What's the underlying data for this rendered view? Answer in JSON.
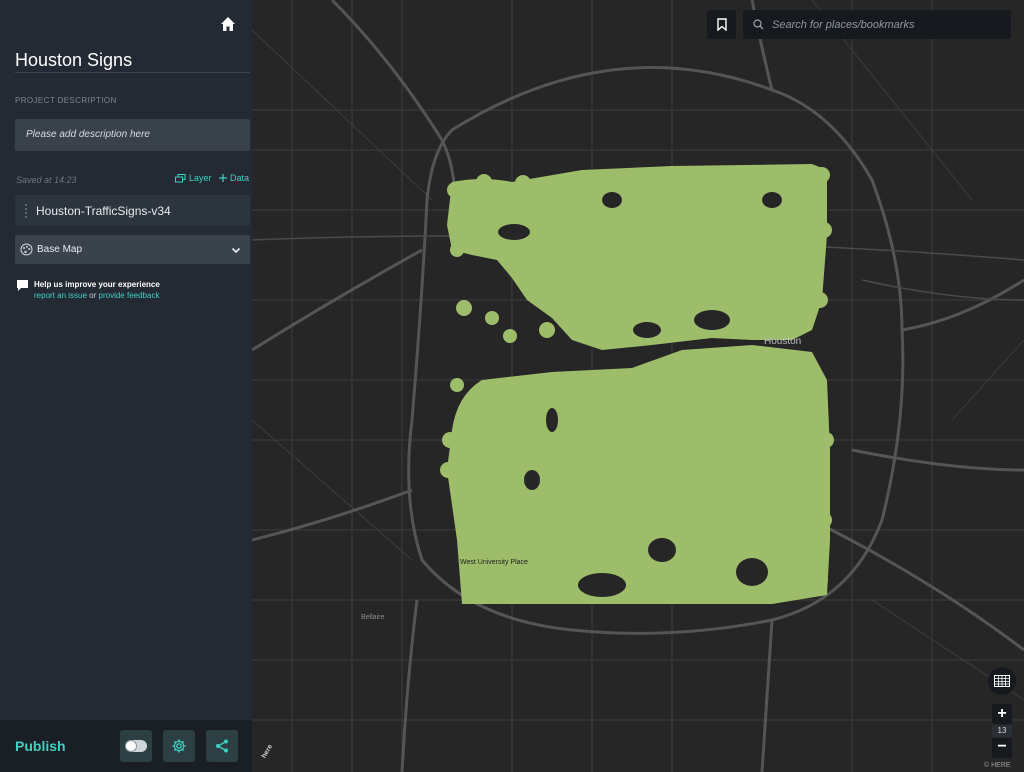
{
  "app": {
    "project_title": "Houston Signs",
    "project_description_label": "PROJECT DESCRIPTION",
    "description_placeholder": "Please add description here",
    "saved_at": "Saved at 14:23",
    "add_layer_label": "Layer",
    "add_data_label": "Data",
    "dataset_name": "Houston-TrafficSigns-v34",
    "basemap_label": "Base Map",
    "help_title": "Help us improve your experience",
    "help_report": "report an issue",
    "help_or": "or",
    "help_feedback": "provide feedback",
    "publish_label": "Publish"
  },
  "map": {
    "search_placeholder": "Search for places/bookmarks",
    "zoom_level": "13",
    "labels": {
      "houston": "Houston",
      "west_university_place": "West University Place",
      "bellaire": "Bellaire",
      "here_logo": "here",
      "copyright": "© HERE"
    },
    "layer_color": "#9dbd6a",
    "road_color": "#4a4a4a",
    "major_road_color": "#585858"
  },
  "icons": {
    "home": "home-icon",
    "layer": "layers-icon",
    "data": "plus-icon",
    "basemap": "palette-icon",
    "chevron": "chevron-down-icon",
    "help": "comment-icon",
    "toggle": "toggle-icon",
    "settings": "gear-icon",
    "share": "share-icon",
    "bookmark": "bookmark-icon",
    "search": "search-icon",
    "table": "table-icon"
  }
}
